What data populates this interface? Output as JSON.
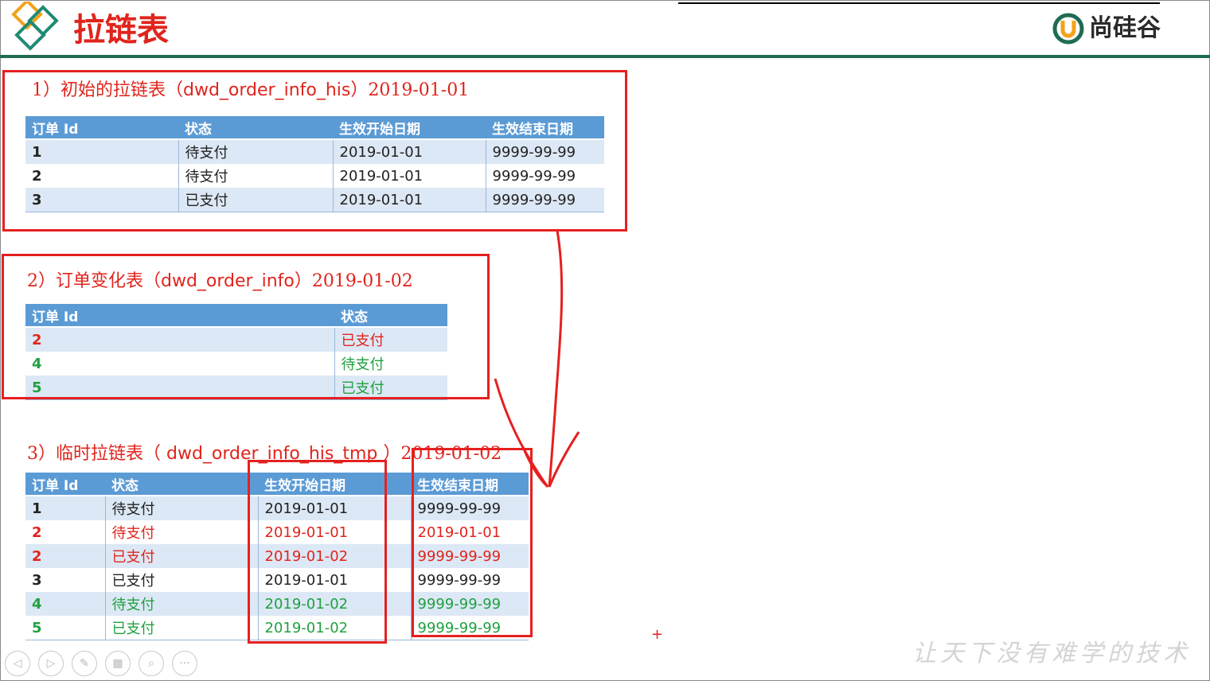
{
  "slide": {
    "title": "拉链表",
    "brand": "尚硅谷",
    "slogan": "让天下没有难学的技术"
  },
  "colors": {
    "accent_red": "#e0241c",
    "green": "#21a040",
    "header_blue": "#5b9bd5",
    "rule_green": "#1f6b55"
  },
  "section1": {
    "title_num": "1）初始的拉链表（",
    "title_name": "dwd_order_info_his",
    "title_tail": "）2019-01-01",
    "headers": [
      "订单 Id",
      "状态",
      "生效开始日期",
      "生效结束日期"
    ],
    "rows": [
      [
        "1",
        "待支付",
        "2019-01-01",
        "9999-99-99"
      ],
      [
        "2",
        "待支付",
        "2019-01-01",
        "9999-99-99"
      ],
      [
        "3",
        "已支付",
        "2019-01-01",
        "9999-99-99"
      ]
    ]
  },
  "section2": {
    "title_num": "2）订单变化表（",
    "title_name": "dwd_order_info",
    "title_tail": "）2019-01-02",
    "headers": [
      "订单 Id",
      "状态"
    ],
    "rows": [
      [
        "2",
        "已支付"
      ],
      [
        "4",
        "待支付"
      ],
      [
        "5",
        "已支付"
      ]
    ]
  },
  "section3": {
    "title_num": "3）临时拉链表（ ",
    "title_name": "dwd_order_info_his_tmp",
    "title_tail": " ）2019-01-02",
    "headers": [
      "订单 Id",
      "状态",
      "生效开始日期",
      "生效结束日期"
    ],
    "rows": [
      [
        "1",
        "待支付",
        "2019-01-01",
        "9999-99-99"
      ],
      [
        "2",
        "待支付",
        "2019-01-01",
        "2019-01-01"
      ],
      [
        "2",
        "已支付",
        "2019-01-02",
        "9999-99-99"
      ],
      [
        "3",
        "已支付",
        "2019-01-01",
        "9999-99-99"
      ],
      [
        "4",
        "待支付",
        "2019-01-02",
        "9999-99-99"
      ],
      [
        "5",
        "已支付",
        "2019-01-02",
        "9999-99-99"
      ]
    ]
  },
  "controls": [
    "prev-icon",
    "next-icon",
    "pen-icon",
    "slides-icon",
    "zoom-icon",
    "more-icon"
  ]
}
